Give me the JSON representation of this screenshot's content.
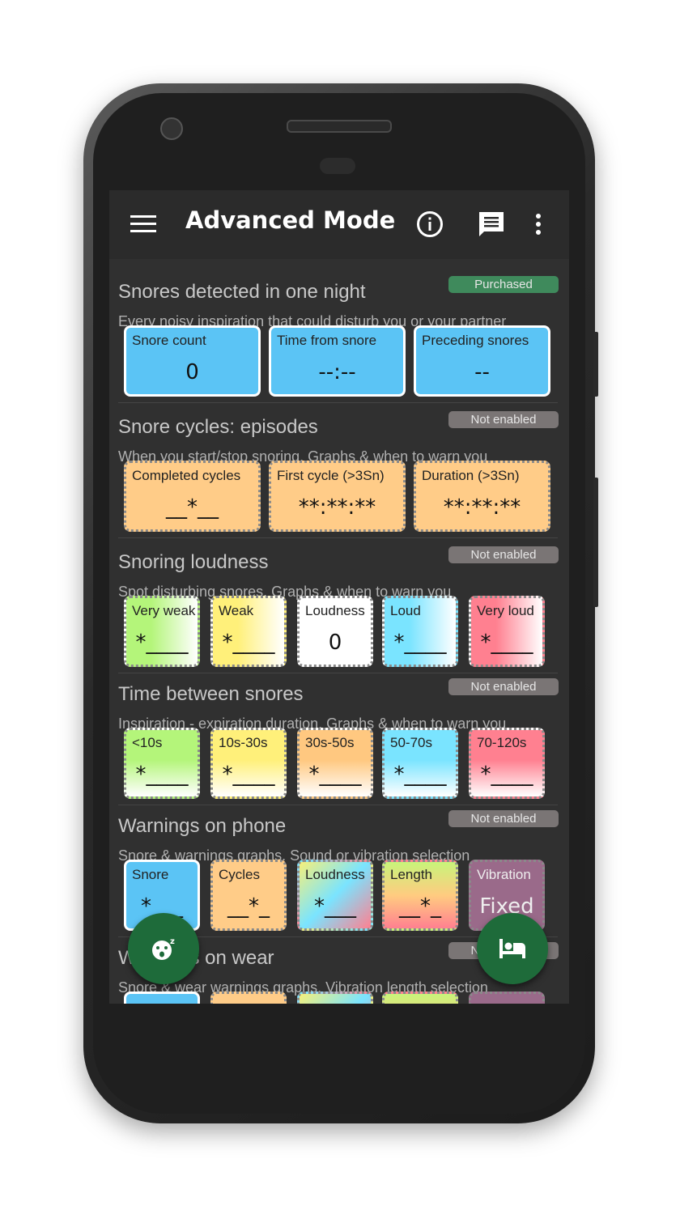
{
  "appbar": {
    "title": "Advanced Mode",
    "icons": [
      "menu-icon",
      "info-icon",
      "chat-icon",
      "more-vert-icon"
    ]
  },
  "colors": {
    "purchased": "#3f8a5c",
    "not_enabled": "#7a7575",
    "fab": "#1e6b3a",
    "appbar": "#2b2b2b",
    "background": "#303030"
  },
  "sections": [
    {
      "title": "Snores detected in one night",
      "badge": "Purchased",
      "badge_type": "purchased",
      "subtitle": "Every noisy inspiration that could disturb you or your partner",
      "cards": [
        {
          "label": "Snore count",
          "value": "0",
          "color": "#5bc4f5",
          "fade": "none",
          "border": "solid"
        },
        {
          "label": "Time from snore",
          "value": "--:--",
          "color": "#5bc4f5",
          "fade": "none",
          "border": "solid"
        },
        {
          "label": "Preceding snores",
          "value": "--",
          "color": "#5bc4f5",
          "fade": "none",
          "border": "solid"
        }
      ]
    },
    {
      "title": "Snore cycles: episodes",
      "badge": "Not enabled",
      "badge_type": "not_enabled",
      "subtitle": "When you start/stop snoring. Graphs & when to warn you",
      "cards": [
        {
          "label": "Completed cycles",
          "value": "__*__",
          "color": "#ffcc88",
          "fade": "none",
          "border": "dashed"
        },
        {
          "label": "First cycle (>3Sn)",
          "value": "**:**:**",
          "color": "#ffcc88",
          "fade": "none",
          "border": "dashed"
        },
        {
          "label": "Duration (>3Sn)",
          "value": "**:**:**",
          "color": "#ffcc88",
          "fade": "none",
          "border": "dashed"
        }
      ]
    },
    {
      "title": "Snoring loudness",
      "badge": "Not enabled",
      "badge_type": "not_enabled",
      "subtitle": "Spot disturbing snores. Graphs & when to warn you",
      "cards": [
        {
          "label": "Very weak",
          "value": "*____",
          "color": "#b4f57a",
          "fade": "right",
          "border": "dashed"
        },
        {
          "label": "Weak",
          "value": "*____",
          "color": "#fff07a",
          "fade": "right",
          "border": "dashed"
        },
        {
          "label": "Loudness",
          "value": "0",
          "color": "#ffffff",
          "fade": "none",
          "border": "dashed"
        },
        {
          "label": "Loud",
          "value": "*____",
          "color": "#7ae4ff",
          "fade": "right",
          "border": "dashed"
        },
        {
          "label": "Very loud",
          "value": "*____",
          "color": "#ff8090",
          "fade": "right",
          "border": "dashed"
        }
      ]
    },
    {
      "title": "Time between snores",
      "badge": "Not enabled",
      "badge_type": "not_enabled",
      "subtitle": "Inspiration - expiration duration. Graphs & when to warn you",
      "cards": [
        {
          "label": "<10s",
          "value": "*____",
          "color": "#b4f57a",
          "fade": "down",
          "border": "dashed"
        },
        {
          "label": "10s-30s",
          "value": "*____",
          "color": "#fff07a",
          "fade": "down",
          "border": "dashed"
        },
        {
          "label": "30s-50s",
          "value": "*____",
          "color": "#ffc880",
          "fade": "down",
          "border": "dashed"
        },
        {
          "label": "50-70s",
          "value": "*____",
          "color": "#7ae4ff",
          "fade": "down",
          "border": "dashed"
        },
        {
          "label": "70-120s",
          "value": "*____",
          "color": "#ff8090",
          "fade": "down",
          "border": "dashed"
        }
      ]
    },
    {
      "title": "Warnings on phone",
      "badge": "Not enabled",
      "badge_type": "not_enabled",
      "subtitle": "Snore & warnings graphs. Sound or vibration selection",
      "cards": [
        {
          "label": "Snore",
          "value": "*___",
          "color": "#5bc4f5",
          "fade": "none",
          "border": "solid"
        },
        {
          "label": "Cycles",
          "value": "__*_",
          "color": "#ffcc88",
          "fade": "none",
          "border": "dashed"
        },
        {
          "label": "Loudness",
          "value": "*___",
          "color": "rainbow",
          "fade": "none",
          "border": "dashed"
        },
        {
          "label": "Length",
          "value": "__*_",
          "color": "sunset",
          "fade": "none",
          "border": "dashed"
        },
        {
          "label": "Vibration",
          "value": "Fixed",
          "color": "#9a6a8a",
          "fade": "none",
          "border": "dashed"
        }
      ]
    },
    {
      "title": "Warnings on wear",
      "badge": "Not enabled",
      "badge_type": "not_enabled",
      "subtitle": "Snore & wear warnings graphs. Vibration length selection",
      "cards": [
        {
          "label": "",
          "value": "",
          "color": "#5bc4f5",
          "fade": "none",
          "border": "solid"
        },
        {
          "label": "",
          "value": "",
          "color": "#ffcc88",
          "fade": "none",
          "border": "dashed"
        },
        {
          "label": "",
          "value": "",
          "color": "rainbow",
          "fade": "none",
          "border": "dashed"
        },
        {
          "label": "",
          "value": "",
          "color": "sunset",
          "fade": "none",
          "border": "dashed"
        },
        {
          "label": "",
          "value": "",
          "color": "#9a6a8a",
          "fade": "none",
          "border": "dashed"
        }
      ]
    }
  ],
  "fabs": [
    {
      "icon": "sleeping-face-icon"
    },
    {
      "icon": "bed-icon"
    }
  ]
}
